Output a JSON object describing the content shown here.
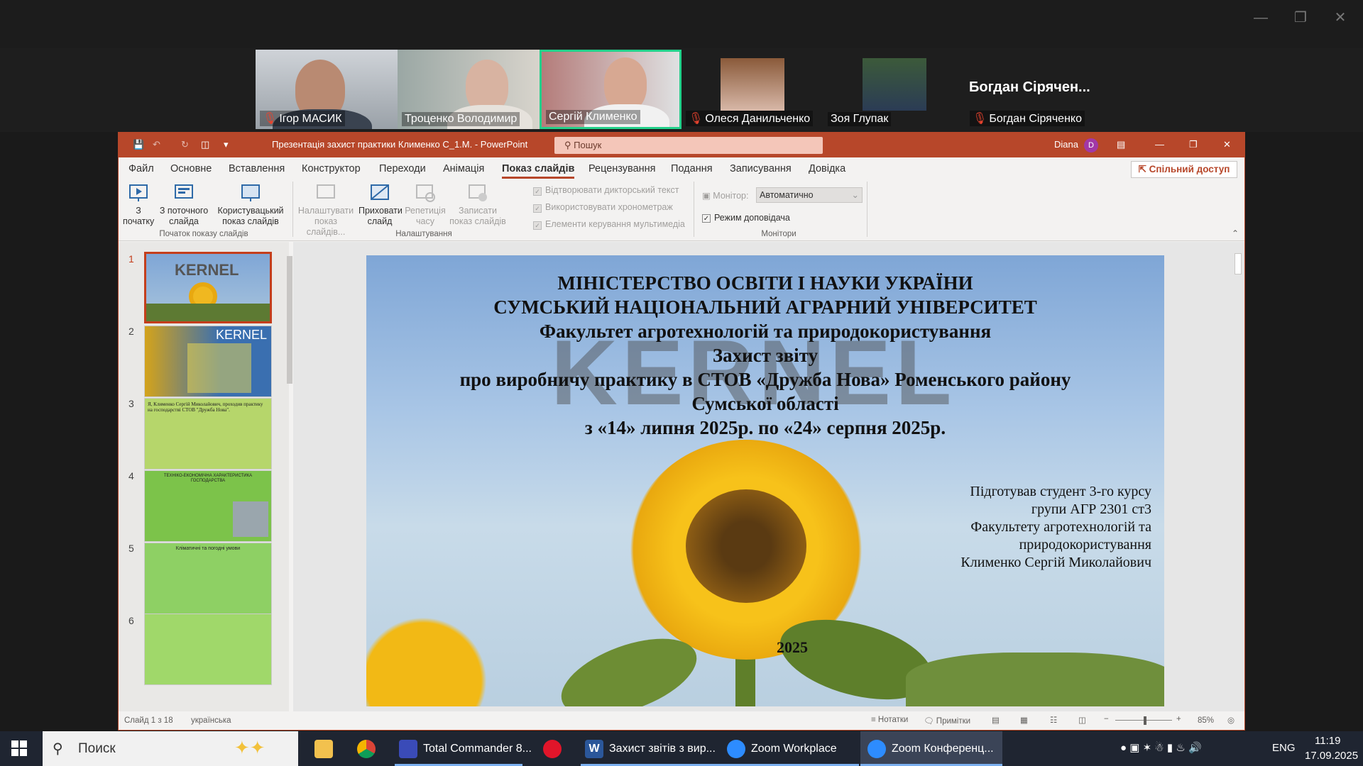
{
  "participants": [
    {
      "name": "Ігор МАСИК",
      "muted": true
    },
    {
      "name": "Троценко Володимир",
      "muted": false
    },
    {
      "name": "Сергій Клименко",
      "muted": false,
      "active_speaker": true
    },
    {
      "name": "Олеся Данильченко",
      "muted": true
    },
    {
      "name": "Зоя Глупак",
      "muted": false
    },
    {
      "name": "Богдан Сіряченко",
      "muted": true,
      "label_large": "Богдан Сірячен..."
    }
  ],
  "ppt": {
    "title": "Презентація захист практики Клименко С_1.М.  -  PowerPoint",
    "search_placeholder": "Пошук",
    "user": "Diana",
    "user_initial": "D",
    "menu": [
      "Файл",
      "Основне",
      "Вставлення",
      "Конструктор",
      "Переходи",
      "Анімація",
      "Показ слайдів",
      "Рецензування",
      "Подання",
      "Записування",
      "Довідка"
    ],
    "active_menu": "Показ слайдів",
    "share": "Спільний доступ",
    "ribbon": {
      "from_start": "З початку",
      "from_current": "З поточного слайда",
      "custom": "Користувацький показ слайдів",
      "group_start": "Початок показу слайдів",
      "setup": "Налаштувати показ слайдів...",
      "hide": "Приховати слайд",
      "rehearse": "Репетиція часу",
      "record": "Записати показ слайдів",
      "chk_narration": "Відтворювати дикторський текст",
      "chk_timings": "Використовувати хронометраж",
      "chk_media": "Елементи керування мультимедіа",
      "group_setup": "Налаштування",
      "monitor_label": "Монітор:",
      "monitor_value": "Автоматично",
      "presenter_view": "Режим доповідача",
      "group_monitors": "Монітори"
    },
    "thumbnails": [
      {
        "num": "1",
        "caption": "KERNEL"
      },
      {
        "num": "2",
        "caption": "KERNEL"
      },
      {
        "num": "3",
        "caption": "Я, Клименко Сергій Миколайович, проходив практику на господарстві СТОВ \"Дружба Нова\"."
      },
      {
        "num": "4",
        "caption": "ТЕХНІКО-ЕКОНОМІЧНА ХАРАКТЕРИСТИКА ГОСПОДАРСТВА"
      },
      {
        "num": "5",
        "caption": "Кліматичні та погодні умови"
      },
      {
        "num": "6",
        "caption": ""
      }
    ],
    "slide": {
      "lines": [
        "МІНІСТЕРСТВО ОСВІТИ І НАУКИ УКРАЇНИ",
        "СУМСЬКИЙ НАЦІОНАЛЬНИЙ АГРАРНИЙ УНІВЕРСИТЕТ",
        "Факультет агротехнологій та природокористування",
        "Захист звіту",
        "про виробничу практику в СТОВ «Дружба Нова» Роменського  району",
        "Сумської  області",
        "з  «14» липня 2025р.  по  «24» серпня 2025р."
      ],
      "watermark": "KERNEL",
      "author": [
        "Підготував студент 3-го курсу",
        "групи АГР 2301 ст3",
        "Факультету агротехнологій та",
        "природокористування",
        "Клименко Сергій Миколайович"
      ],
      "year": "2025"
    },
    "status": {
      "slide_info": "Слайд 1 з 18",
      "language": "українська",
      "notes": "Нотатки",
      "comments": "Примітки",
      "zoom": "85%"
    }
  },
  "taskbar": {
    "search": "Поиск",
    "apps": [
      {
        "label": "Total Commander 8...",
        "color": "#3a4bb8"
      },
      {
        "label": "Захист звітів з вир...",
        "color": "#2b579a"
      },
      {
        "label": "Zoom Workplace",
        "color": "#2d8cff"
      },
      {
        "label": "Zoom Конференц...",
        "color": "#2d8cff"
      }
    ],
    "lang": "ENG",
    "time": "11:19",
    "date": "17.09.2025"
  }
}
